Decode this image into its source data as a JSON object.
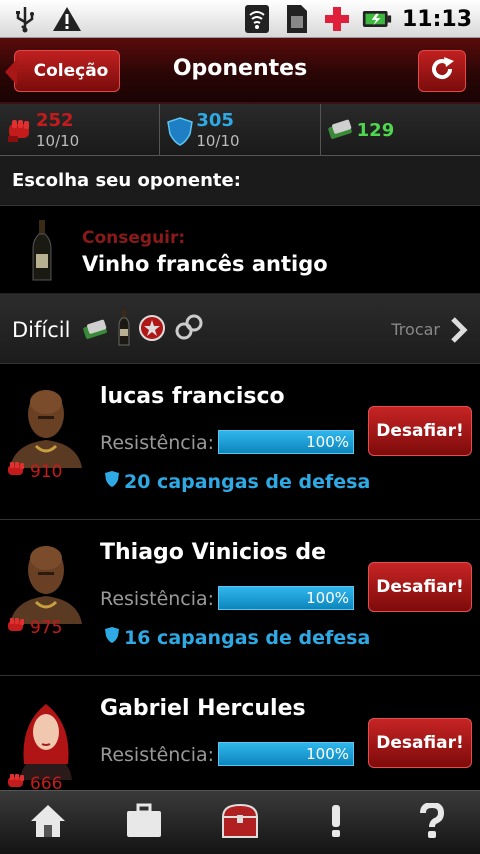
{
  "status_bar": {
    "time": "11:13",
    "icons": [
      "usb-icon",
      "warning-icon",
      "wifi-icon",
      "sim-icon",
      "health-cross-icon",
      "battery-icon"
    ]
  },
  "header": {
    "back_label": "Coleção",
    "title": "Oponentes"
  },
  "stats": {
    "attack": {
      "value": "252",
      "count": "10/10"
    },
    "defense": {
      "value": "305",
      "count": "10/10"
    },
    "cash": {
      "value": "129"
    }
  },
  "choose_label": "Escolha seu oponente:",
  "reward": {
    "label": "Conseguir:",
    "item": "Vinho francês antigo"
  },
  "difficulty": {
    "name": "Difícil",
    "swap_label": "Trocar"
  },
  "opponents": [
    {
      "name": "lucas francisco",
      "resistance_label": "Resistência:",
      "resistance_pct": "100%",
      "attack": "910",
      "defense_text": "20 capangas de defesa",
      "button": "Desafiar!"
    },
    {
      "name": "Thiago Vinicios de",
      "resistance_label": "Resistência:",
      "resistance_pct": "100%",
      "attack": "975",
      "defense_text": "16 capangas de defesa",
      "button": "Desafiar!"
    },
    {
      "name": "Gabriel Hercules",
      "resistance_label": "Resistência:",
      "resistance_pct": "100%",
      "attack": "666",
      "defense_text": "",
      "button": "Desafiar!"
    }
  ],
  "nav": [
    "home-icon",
    "briefcase-icon",
    "treasure-chest-icon",
    "exclamation-icon",
    "help-icon"
  ],
  "colors": {
    "accent_red": "#c62424",
    "attack_red": "#c41c1c",
    "defense_blue": "#2ea9e3",
    "cash_green": "#4fd84f"
  }
}
